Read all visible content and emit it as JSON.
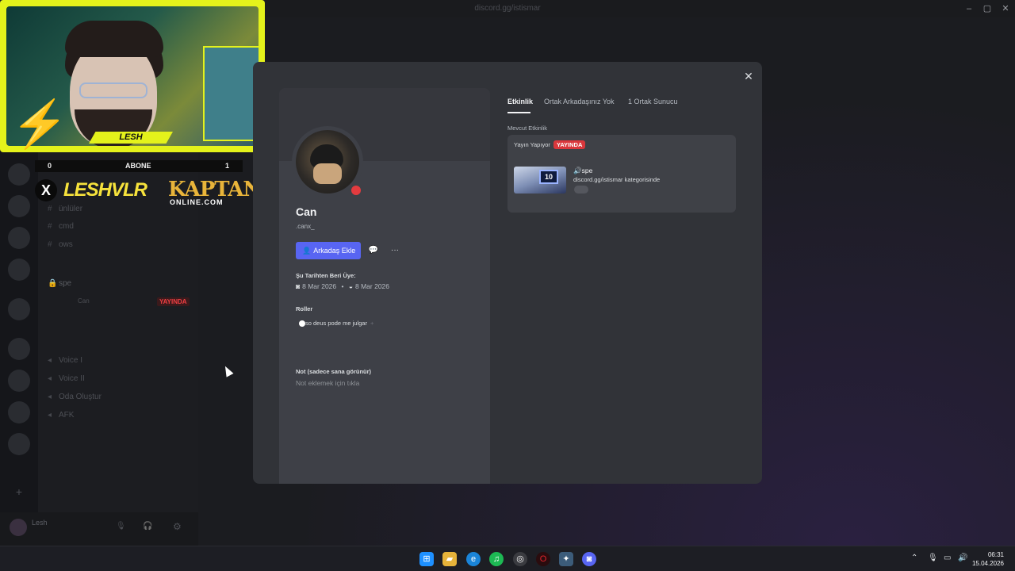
{
  "window": {
    "url": "discord.gg/istismar"
  },
  "webcam": {
    "streamer_name": "LESH"
  },
  "overlay": {
    "sub_left": "0",
    "sub_label": "ABONE",
    "sub_right": "1",
    "x_glyph": "X",
    "brand": "LESHVLR",
    "sponsor_main": "KAPTAN",
    "sponsor_sub": "ONLINE.COM"
  },
  "channels": {
    "items": [
      "ünlüler",
      "cmd",
      "ows",
      "spe",
      "Can",
      "Voice I",
      "Voice II",
      "Oda Oluştur",
      "AFK"
    ],
    "live_tag": "YAYINDA"
  },
  "user_panel": {
    "name": "Lesh"
  },
  "profile": {
    "display_name": "Can",
    "username": ".canx_",
    "add_friend_label": "Arkadaş Ekle",
    "member_since_label": "Şu Tarihten Beri Üye:",
    "discord_date": "8 Mar 2026",
    "server_date": "8 Mar 2026",
    "roles_label": "Roller",
    "role_name": "so deus pode me julgar",
    "note_label": "Not (sadece sana görünür)",
    "note_placeholder": "Not eklemek için tıkla"
  },
  "tabs": {
    "activity": "Etkinlik",
    "mutual_friends": "Ortak Arkadaşınız Yok",
    "mutual_servers": "1 Ortak Sunucu"
  },
  "activity": {
    "section_label": "Mevcut Etkinlik",
    "streaming_label": "Yayın Yapıyor",
    "live_badge": "YAYINDA",
    "channel_name": "spe",
    "channel_desc": "discord.gg/istismar kategorisinde",
    "thumb_number": "10"
  },
  "taskbar": {
    "time": "06:31",
    "date": "15.04.2026"
  },
  "colors": {
    "blurple": "#5865f2",
    "live_red": "#da373c",
    "webcam_frame": "#e4f21b"
  },
  "icons": {
    "close": "close-icon",
    "message": "message-icon",
    "more": "more-icon",
    "add_friend": "add-friend-icon"
  }
}
